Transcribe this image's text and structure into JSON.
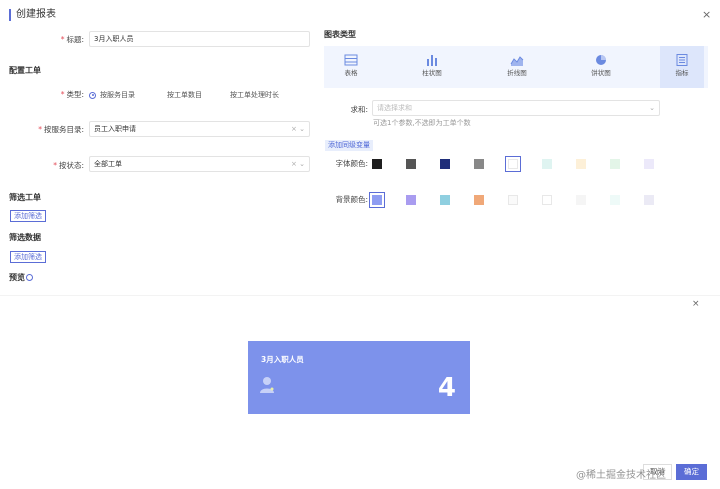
{
  "header": {
    "title": "创建报表",
    "close_icon": "×"
  },
  "form": {
    "title_label": "标题:",
    "title_value": "3月入职人员",
    "config_section": "配置工单",
    "type_label": "类型:",
    "type_options": [
      "按服务目录",
      "按工单数目",
      "按工单处理时长"
    ],
    "type_selected": "按服务目录",
    "catalog_label": "按服务目录:",
    "catalog_value": "员工入职申请",
    "status_label": "按状态:",
    "status_value": "全部工单",
    "filter_ticket_section": "筛选工单",
    "add_filter_1": "添加筛选",
    "filter_data_section": "筛选数据",
    "add_filter_2": "添加筛选",
    "preview_label": "预览"
  },
  "chart_types": {
    "section": "图表类型",
    "items": [
      "表格",
      "柱状图",
      "折线图",
      "饼状图",
      "指标"
    ],
    "selected": "指标"
  },
  "metric": {
    "sum_label": "求和:",
    "sum_placeholder": "请选择求和",
    "hint": "可选1个参数,不选即为工单个数",
    "add_var": "添加同级变量",
    "font_color_label": "字体颜色:",
    "bg_color_label": "背景颜色:",
    "font_colors": [
      "#1f1f1f",
      "#555555",
      "#1f2e7a",
      "#888888",
      "#ffffff",
      "#dff4f1",
      "#fdf0d8",
      "#e3f5e8",
      "#ece9fa"
    ],
    "font_color_selected_index": 4,
    "bg_colors": [
      "#8f9df2",
      "#a99cf0",
      "#8fcfe0",
      "#f0a878",
      "#fafafa",
      "#ffffff",
      "#f5f5f5",
      "#eefaf8",
      "#ebeaf5"
    ],
    "bg_color_selected_index": 0
  },
  "preview": {
    "close_icon": "×",
    "card_title": "3月入职人员",
    "card_value": "4",
    "card_color": "#7d92eb"
  },
  "footer": {
    "cancel": "取消",
    "confirm": "确定",
    "watermark": "@稀土掘金技术社区"
  },
  "colors": {
    "accent": "#5b6dd6"
  }
}
